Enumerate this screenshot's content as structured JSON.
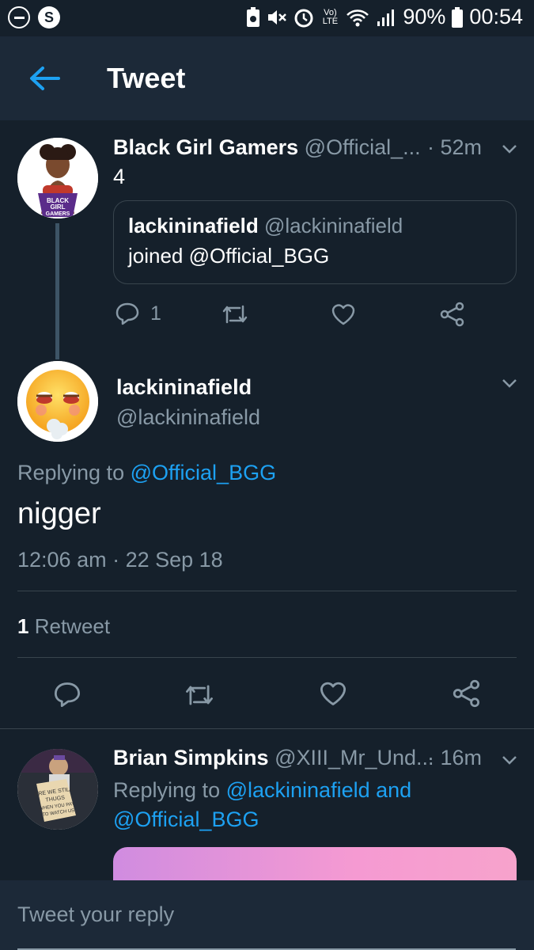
{
  "status_bar": {
    "battery": "90%",
    "time": "00:54",
    "lte_label": "Vo) LTE"
  },
  "header": {
    "title": "Tweet",
    "back_icon": "arrow-left-icon"
  },
  "parent_tweet": {
    "name": "Black Girl Gamers",
    "handle": "@Official_...",
    "time": "· 52m",
    "text": "4",
    "quoted": {
      "name": "lackininafield",
      "handle": "@lackininafield",
      "text": "joined @Official_BGG"
    },
    "reply_count": "1"
  },
  "main_tweet": {
    "name": "lackininafield",
    "handle": "@lackininafield",
    "replying_prefix": "Replying to",
    "replying_to": "@Official_BGG",
    "text": "nigger",
    "timestamp": "12:06 am · 22 Sep 18",
    "retweet_count": "1",
    "retweet_label": "Retweet"
  },
  "reply_tweet": {
    "name": "Brian Simpkins",
    "handle": "@XIII_Mr_Und...",
    "time": "· 16m",
    "replying_prefix": "Replying to",
    "replying_to_1": "@lackininafield and",
    "replying_to_2": "@Official_BGG"
  },
  "reply_bar": {
    "placeholder": "Tweet your reply"
  },
  "colors": {
    "background": "#15202b",
    "header": "#1c2938",
    "accent": "#1da1f2",
    "muted": "#8899a6",
    "divider": "#38444d"
  }
}
